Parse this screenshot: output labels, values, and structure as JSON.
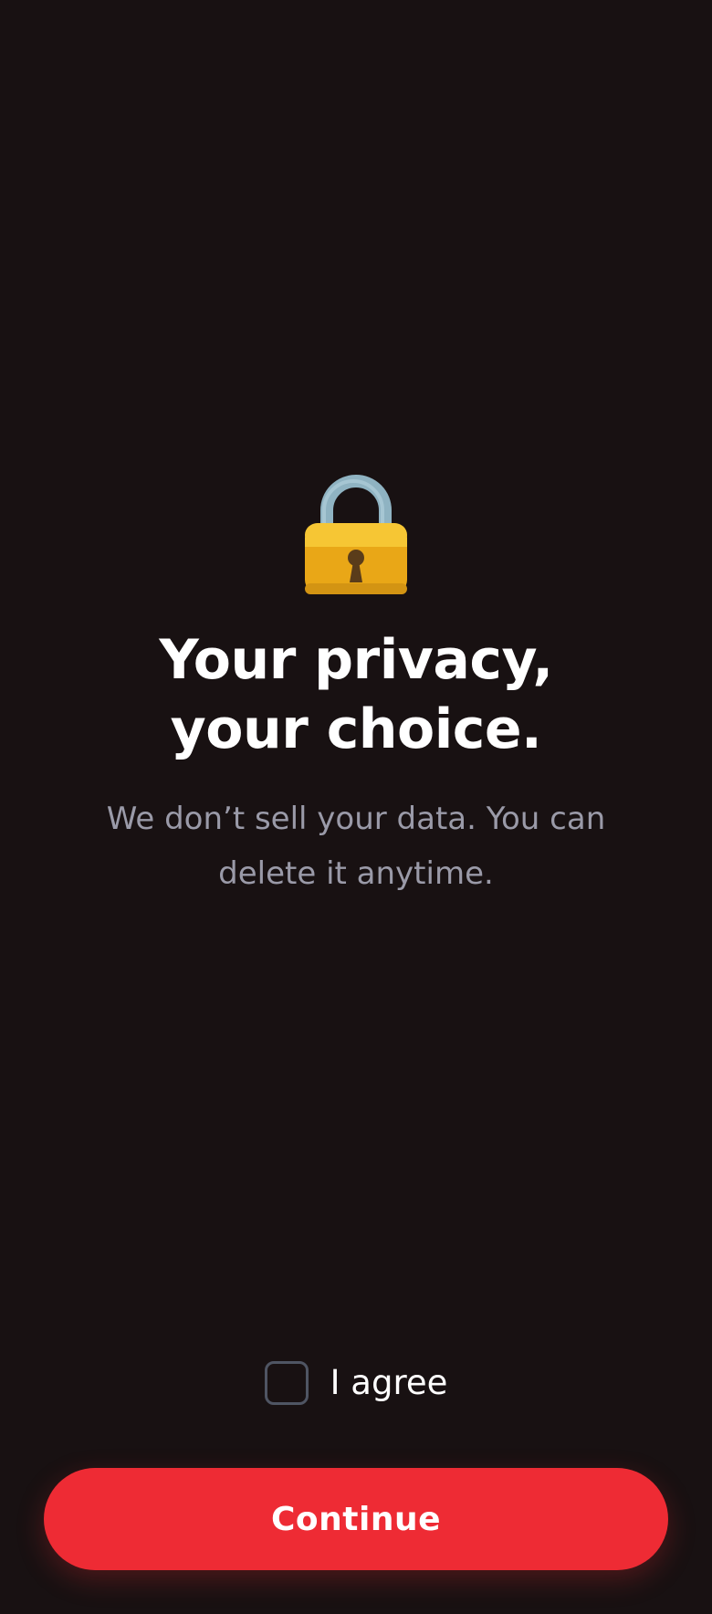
{
  "hero": {
    "icon": "lock-icon",
    "title": "Your privacy, your choice.",
    "subtitle": "We don’t sell your data. You can delete it anytime."
  },
  "consent": {
    "checkbox_checked": false,
    "label": "I agree"
  },
  "actions": {
    "continue_label": "Continue"
  },
  "colors": {
    "background": "#181112",
    "accent": "#ee2b34",
    "lock_body": "#f2b317",
    "lock_shackle": "#8fb3c2",
    "subtitle_text": "#9a9aa8",
    "checkbox_border": "#4f5563"
  }
}
